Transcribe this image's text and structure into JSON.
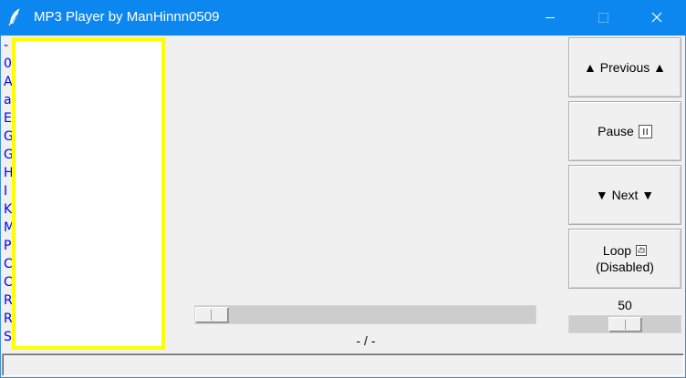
{
  "window": {
    "title": "MP3 Player by ManHinnn0509",
    "title_icon": "feather-icon",
    "titlebar_color": "#0d87f0"
  },
  "letter_index": [
    "-",
    "0",
    "A",
    "a",
    "E",
    "G",
    "G",
    "H",
    "I",
    "K",
    "M",
    "P",
    "C",
    "C",
    "R",
    "R",
    "S"
  ],
  "playlist": {
    "items": [],
    "border_color": "#ffff00"
  },
  "player": {
    "progress_fraction": 0,
    "time_display": "- / -"
  },
  "controls": {
    "previous_label": "▲ Previous ▲",
    "pause_label": "Pause",
    "pause_icon": "pause-icon",
    "next_label": "▼ Next ▼",
    "loop_label": "Loop",
    "loop_icon": "loop-icon",
    "loop_state": "(Disabled)"
  },
  "volume": {
    "value_label": "50",
    "level": 50,
    "max": 100
  },
  "status_bar": {
    "text": ""
  },
  "colors": {
    "letter_link": "#0000ff",
    "window_bg": "#f0f0f0"
  }
}
